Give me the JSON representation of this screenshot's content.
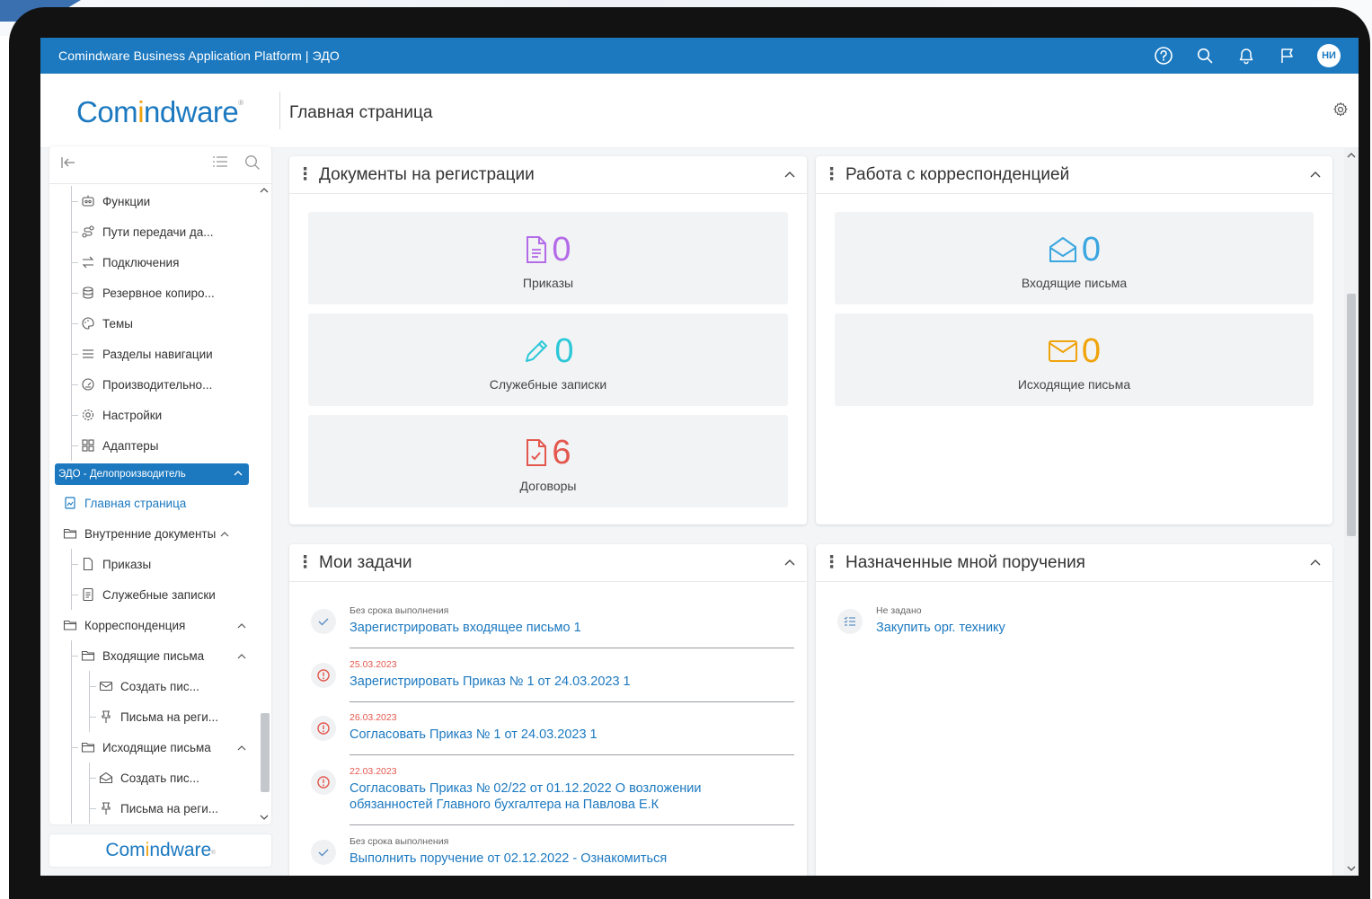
{
  "window": {
    "app_title": "Comindware Business Application Platform  |  ЭДО",
    "avatar_initials": "НИ"
  },
  "header": {
    "logo_text_a": "Com",
    "logo_text_o": "i",
    "logo_text_b": "ndware",
    "page_title": "Главная страница"
  },
  "sidebar": {
    "admin_items": [
      {
        "label": "Функции",
        "icon": "functions-icon"
      },
      {
        "label": "Пути передачи да...",
        "icon": "data-paths-icon"
      },
      {
        "label": "Подключения",
        "icon": "connections-icon"
      },
      {
        "label": "Резервное копиро...",
        "icon": "backup-icon"
      },
      {
        "label": "Темы",
        "icon": "palette-icon"
      },
      {
        "label": "Разделы навигации",
        "icon": "menu-icon"
      },
      {
        "label": "Производительно...",
        "icon": "speedometer-icon"
      },
      {
        "label": "Настройки",
        "icon": "gear-icon"
      },
      {
        "label": "Адаптеры",
        "icon": "adapters-icon"
      }
    ],
    "section_label": "ЭДО - Делопроизводитель",
    "home_label": "Главная страница",
    "internal_docs_label": "Внутренние документы",
    "internal_children": [
      "Приказы",
      "Служебные записки"
    ],
    "correspondence_label": "Корреспонденция",
    "incoming_label": "Входящие письма",
    "incoming_children": [
      "Создать пис...",
      "Письма на реги..."
    ],
    "outgoing_label": "Исходящие письма",
    "outgoing_children": [
      "Создать пис...",
      "Письма на реги..."
    ],
    "footer_logo_a": "Com",
    "footer_logo_o": "i",
    "footer_logo_b": "ndware"
  },
  "widgets": {
    "registration": {
      "title": "Документы на регистрации",
      "counters": [
        {
          "value": "0",
          "label": "Приказы",
          "color": "#b46be8",
          "icon": "document-icon"
        },
        {
          "value": "0",
          "label": "Служебные записки",
          "color": "#2cc8d8",
          "icon": "pencil-icon"
        },
        {
          "value": "6",
          "label": "Договоры",
          "color": "#e3584e",
          "icon": "contract-icon"
        }
      ]
    },
    "correspondence": {
      "title": "Работа с корреспонденцией",
      "counters": [
        {
          "value": "0",
          "label": "Входящие письма",
          "color": "#3aa6e0",
          "icon": "open-envelope-icon"
        },
        {
          "value": "0",
          "label": "Исходящие письма",
          "color": "#f0a30a",
          "icon": "envelope-icon"
        }
      ]
    },
    "my_tasks": {
      "title": "Мои задачи",
      "tasks": [
        {
          "meta": "Без срока выполнения",
          "title": "Зарегистрировать входящее письмо 1",
          "status": "check"
        },
        {
          "meta": "25.03.2023",
          "title": "Зарегистрировать Приказ № 1 от 24.03.2023 1",
          "status": "overdue"
        },
        {
          "meta": "26.03.2023",
          "title": "Согласовать Приказ № 1 от 24.03.2023 1",
          "status": "overdue"
        },
        {
          "meta": "22.03.2023",
          "title": "Согласовать Приказ № 02/22 от 01.12.2022 О возложении обязанностей Главного бухгалтера на Павлова Е.К",
          "status": "overdue"
        },
        {
          "meta": "Без срока выполнения",
          "title": "Выполнить поручение от 02.12.2022 - Ознакомиться",
          "status": "check"
        }
      ]
    },
    "assigned": {
      "title": "Назначенные мной поручения",
      "items": [
        {
          "meta": "Не задано",
          "title": "Закупить орг. технику"
        }
      ]
    }
  },
  "colors": {
    "brand": "#1c79c0",
    "accent": "#f0a30a",
    "overdue": "#e3584e"
  }
}
